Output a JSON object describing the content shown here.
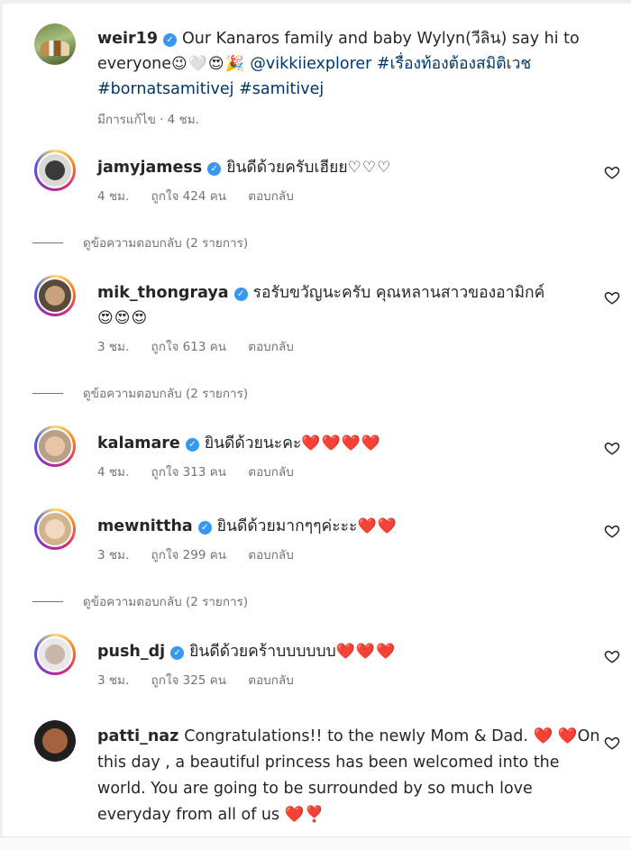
{
  "caption": {
    "username": "weir19",
    "text": "Our Kanaros family and baby Wylyn(วีลิน) say hi to everyone",
    "emojis": "😉🤍😍🎉",
    "mention": "@vikkiiexplorer",
    "hashtag1": "#เรื่องท้องต้องสมิติเวช",
    "hashtag2": "#bornatsamitivej",
    "hashtag3": "#samitivej",
    "meta": "มีการแก้ไข · 4 ชม."
  },
  "labels": {
    "like": "ถูกใจ",
    "people": "คน",
    "reply": "ตอบกลับ",
    "view_replies": "ดูข้อความตอบกลับ (2 รายการ)"
  },
  "comments": [
    {
      "username": "jamyjamess",
      "verified": true,
      "text": "ยินดีด้วยครับเฮียย",
      "emojis": "♡♡♡",
      "time": "4 ชม.",
      "likes": "ถูกใจ 424 คน",
      "has_replies": true
    },
    {
      "username": "mik_thongraya",
      "verified": true,
      "text": "รอรับขวัญนะครับ คุณหลานสาวของอามิกค์",
      "emojis": "😍😍😍",
      "time": "3 ชม.",
      "likes": "ถูกใจ 613 คน",
      "has_replies": true
    },
    {
      "username": "kalamare",
      "verified": true,
      "text": "ยินดีด้วยนะคะ",
      "emojis": "❤️❤️❤️❤️",
      "time": "4 ชม.",
      "likes": "ถูกใจ 313 คน",
      "has_replies": false
    },
    {
      "username": "mewnittha",
      "verified": true,
      "text": "ยินดีด้วยมากๆๆค่ะะะ",
      "emojis": "❤️❤️",
      "time": "3 ชม.",
      "likes": "ถูกใจ 299 คน",
      "has_replies": true
    },
    {
      "username": "push_dj",
      "verified": true,
      "text": "ยินดีด้วยคร้าบบบบบบ",
      "emojis": "❤️❤️❤️",
      "time": "3 ชม.",
      "likes": "ถูกใจ 325 คน",
      "has_replies": false
    },
    {
      "username": "patti_naz",
      "verified": false,
      "text": "Congratulations!! to the newly Mom & Dad. ❤️ ❤️On this day , a beautiful princess has been welcomed into the world. You are going to be surrounded by so much love everyday from all of us ❤️❣️"
    }
  ],
  "icons": {
    "verified": "verified-badge-icon",
    "like": "heart-outline-icon"
  },
  "colors": {
    "verified": "#3897f0",
    "link": "#00376b",
    "meta": "#737373",
    "heart": "#ed4956"
  }
}
